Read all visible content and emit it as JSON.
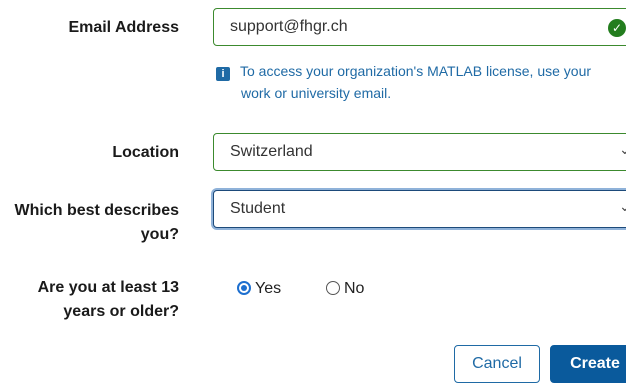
{
  "email": {
    "label": "Email Address",
    "value": "support@fhgr.ch",
    "status_icon": "check-circle-icon",
    "info_icon": "info-icon",
    "info_line1": "To access your organization's MATLAB license, use your",
    "info_line2": "work or university email."
  },
  "location": {
    "label": "Location",
    "value": "Switzerland"
  },
  "describes": {
    "label_line1": "Which best describes",
    "label_line2": "you?",
    "value": "Student"
  },
  "age": {
    "label_line1": "Are you at least 13",
    "label_line2": "years or older?",
    "options": [
      "Yes",
      "No"
    ],
    "selected": "Yes"
  },
  "buttons": {
    "cancel": "Cancel",
    "create": "Create"
  },
  "colors": {
    "valid_border": "#3c8a2e",
    "focus_border": "#1d4a7a",
    "info_text": "#1f6aa5",
    "primary": "#0a5a9c"
  }
}
